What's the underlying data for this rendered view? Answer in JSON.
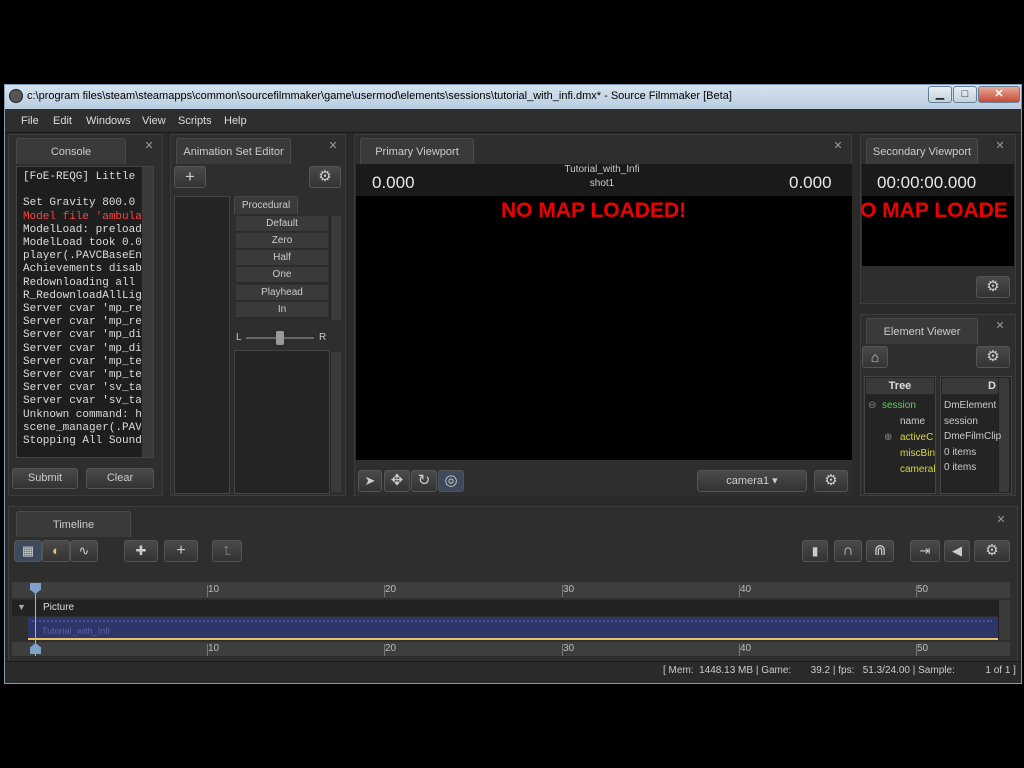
{
  "window": {
    "title": "c:\\program files\\steam\\steamapps\\common\\sourcefilmmaker\\game\\usermod\\elements\\sessions\\tutorial_with_infi.dmx* - Source Filmmaker [Beta]",
    "minimize": "▁",
    "maximize": "□",
    "close": "✕"
  },
  "menu": [
    "File",
    "Edit",
    "Windows",
    "View",
    "Scripts",
    "Help"
  ],
  "console": {
    "tab": "Console",
    "lines": [
      {
        "text": "[FoE-REQG] Little P",
        "color": "#dddddd"
      },
      {
        "text": "",
        "color": "#dddddd"
      },
      {
        "text": "Set Gravity 800.0 (",
        "color": "#dddddd"
      },
      {
        "text": "Model file 'ambulan",
        "color": "#ff4040"
      },
      {
        "text": "ModelLoad:  preload",
        "color": "#dddddd"
      },
      {
        "text": "ModelLoad took 0.01",
        "color": "#dddddd"
      },
      {
        "text": "player(.PAVCBaseEnt",
        "color": "#dddddd"
      },
      {
        "text": "Achievements disabl",
        "color": "#dddddd"
      },
      {
        "text": "Redownloading all l",
        "color": "#dddddd"
      },
      {
        "text": "R_RedownloadAllLigh",
        "color": "#dddddd"
      },
      {
        "text": "Server cvar 'mp_res",
        "color": "#dddddd"
      },
      {
        "text": "Server cvar 'mp_res",
        "color": "#dddddd"
      },
      {
        "text": "Server cvar 'mp_dis",
        "color": "#dddddd"
      },
      {
        "text": "Server cvar 'mp_dis",
        "color": "#dddddd"
      },
      {
        "text": "Server cvar 'mp_tea",
        "color": "#dddddd"
      },
      {
        "text": "Server cvar 'mp_tea",
        "color": "#dddddd"
      },
      {
        "text": "Server cvar 'sv_tag",
        "color": "#dddddd"
      },
      {
        "text": "Server cvar 'sv_tag",
        "color": "#dddddd"
      },
      {
        "text": "Unknown command: he",
        "color": "#dddddd"
      },
      {
        "text": "scene_manager(.PAVC",
        "color": "#dddddd"
      },
      {
        "text": "Stopping All Sounds",
        "color": "#dddddd"
      }
    ],
    "submit": "Submit",
    "clear": "Clear"
  },
  "anim": {
    "tab": "Animation Set Editor",
    "add": "+",
    "gear": "⚙",
    "procedural_tab": "Procedural",
    "buttons": [
      "Default",
      "Zero",
      "Half",
      "One",
      "Playhead",
      "In"
    ],
    "left": "L",
    "right": "R"
  },
  "primary": {
    "tab": "Primary Viewport",
    "session": "Tutorial_with_Infi",
    "shot": "shot1",
    "left_value": "0.000",
    "right_value": "0.000",
    "nomap": "NO MAP LOADED!",
    "camera": "camera1",
    "gear": "⚙"
  },
  "secondary": {
    "tab": "Secondary Viewport",
    "time": "00:00:00.000",
    "nomap": "O MAP LOADE",
    "gear": "⚙"
  },
  "element": {
    "tab": "Element Viewer",
    "gear": "⚙",
    "col_tree": "Tree",
    "col_d": "D",
    "tree": [
      {
        "text": "session",
        "color": "#5ccf5c"
      },
      {
        "text": "name",
        "color": "#cccccc"
      },
      {
        "text": "activeC",
        "color": "#d8d83c"
      },
      {
        "text": "miscBin",
        "color": "#d8d83c"
      },
      {
        "text": "cameral",
        "color": "#d8d83c"
      }
    ],
    "values": [
      "DmElement",
      "session",
      "DmeFilmClip",
      "0 items",
      "0 items"
    ]
  },
  "timeline": {
    "tab": "Timeline",
    "ticks_top": [
      "10",
      "20",
      "30",
      "40",
      "50"
    ],
    "ticks_bottom": [
      "10",
      "20",
      "30",
      "40",
      "50"
    ],
    "track": "Picture",
    "clip": "Tutorial_with_Infi"
  },
  "status": {
    "text": "[ Mem:  1448.13 MB | Game:       39.2 | fps:   51.3/24.00 | Sample:           1 of 1 ]"
  },
  "colors": {
    "accent": "#e8c26a",
    "clip": "#2e3568",
    "nomap": "#ee0000"
  }
}
